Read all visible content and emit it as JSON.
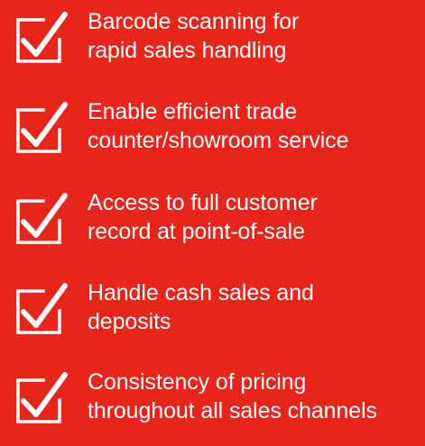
{
  "background_color": "#e8251b",
  "text_color": "#ffffff",
  "icon": "checkbox-check-icon",
  "features": [
    {
      "line1": "Barcode scanning for",
      "line2": "rapid sales handling"
    },
    {
      "line1": "Enable efficient trade",
      "line2": "counter/showroom service"
    },
    {
      "line1": "Access to full customer",
      "line2": "record at point-of-sale"
    },
    {
      "line1": "Handle cash sales and",
      "line2": "deposits"
    },
    {
      "line1": "Consistency of pricing",
      "line2": "throughout all sales channels"
    }
  ]
}
